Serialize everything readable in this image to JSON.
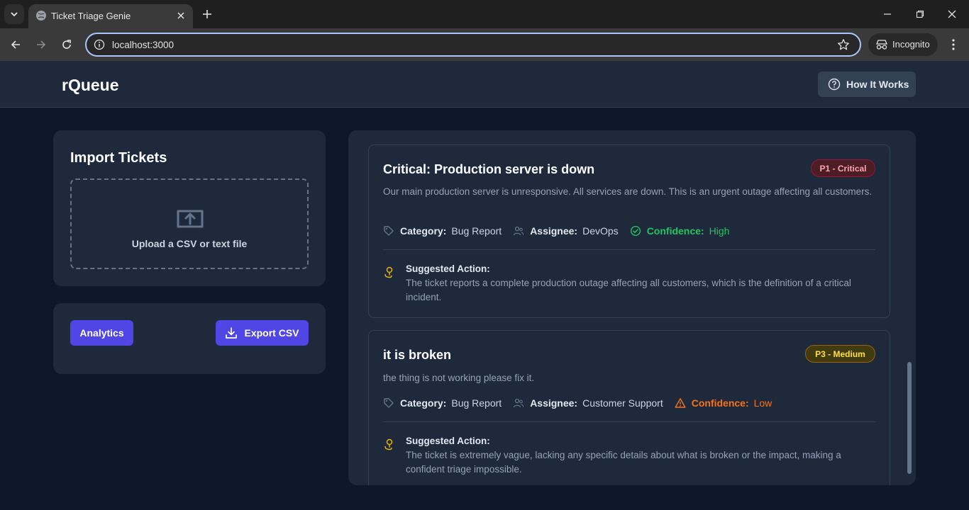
{
  "browser": {
    "tab_title": "Ticket Triage Genie",
    "url": "localhost:3000",
    "incognito_label": "Incognito"
  },
  "header": {
    "brand": "rQueue",
    "how_label": "How It Works"
  },
  "import": {
    "title": "Import Tickets",
    "upload_label": "Upload a CSV or text file"
  },
  "actions": {
    "analytics_label": "Analytics",
    "export_label": "Export CSV"
  },
  "labels": {
    "category": "Category:",
    "assignee": "Assignee:",
    "confidence": "Confidence:",
    "suggested_action": "Suggested Action:"
  },
  "tickets": [
    {
      "title": "Critical: Production server is down",
      "priority": "P1 - Critical",
      "description": "Our main production server is unresponsive. All services are down. This is an urgent outage affecting all customers.",
      "category": "Bug Report",
      "assignee": "DevOps",
      "confidence": "High",
      "confidence_color": "#22c55e",
      "suggested_action": "The ticket reports a complete production outage affecting all customers, which is the definition of a critical incident."
    },
    {
      "title": "it is broken",
      "priority": "P3 - Medium",
      "description": "the thing is not working please fix it.",
      "category": "Bug Report",
      "assignee": "Customer Support",
      "confidence": "Low",
      "confidence_color": "#f97316",
      "suggested_action": "The ticket is extremely vague, lacking any specific details about what is broken or the impact, making a confident triage impossible."
    }
  ]
}
